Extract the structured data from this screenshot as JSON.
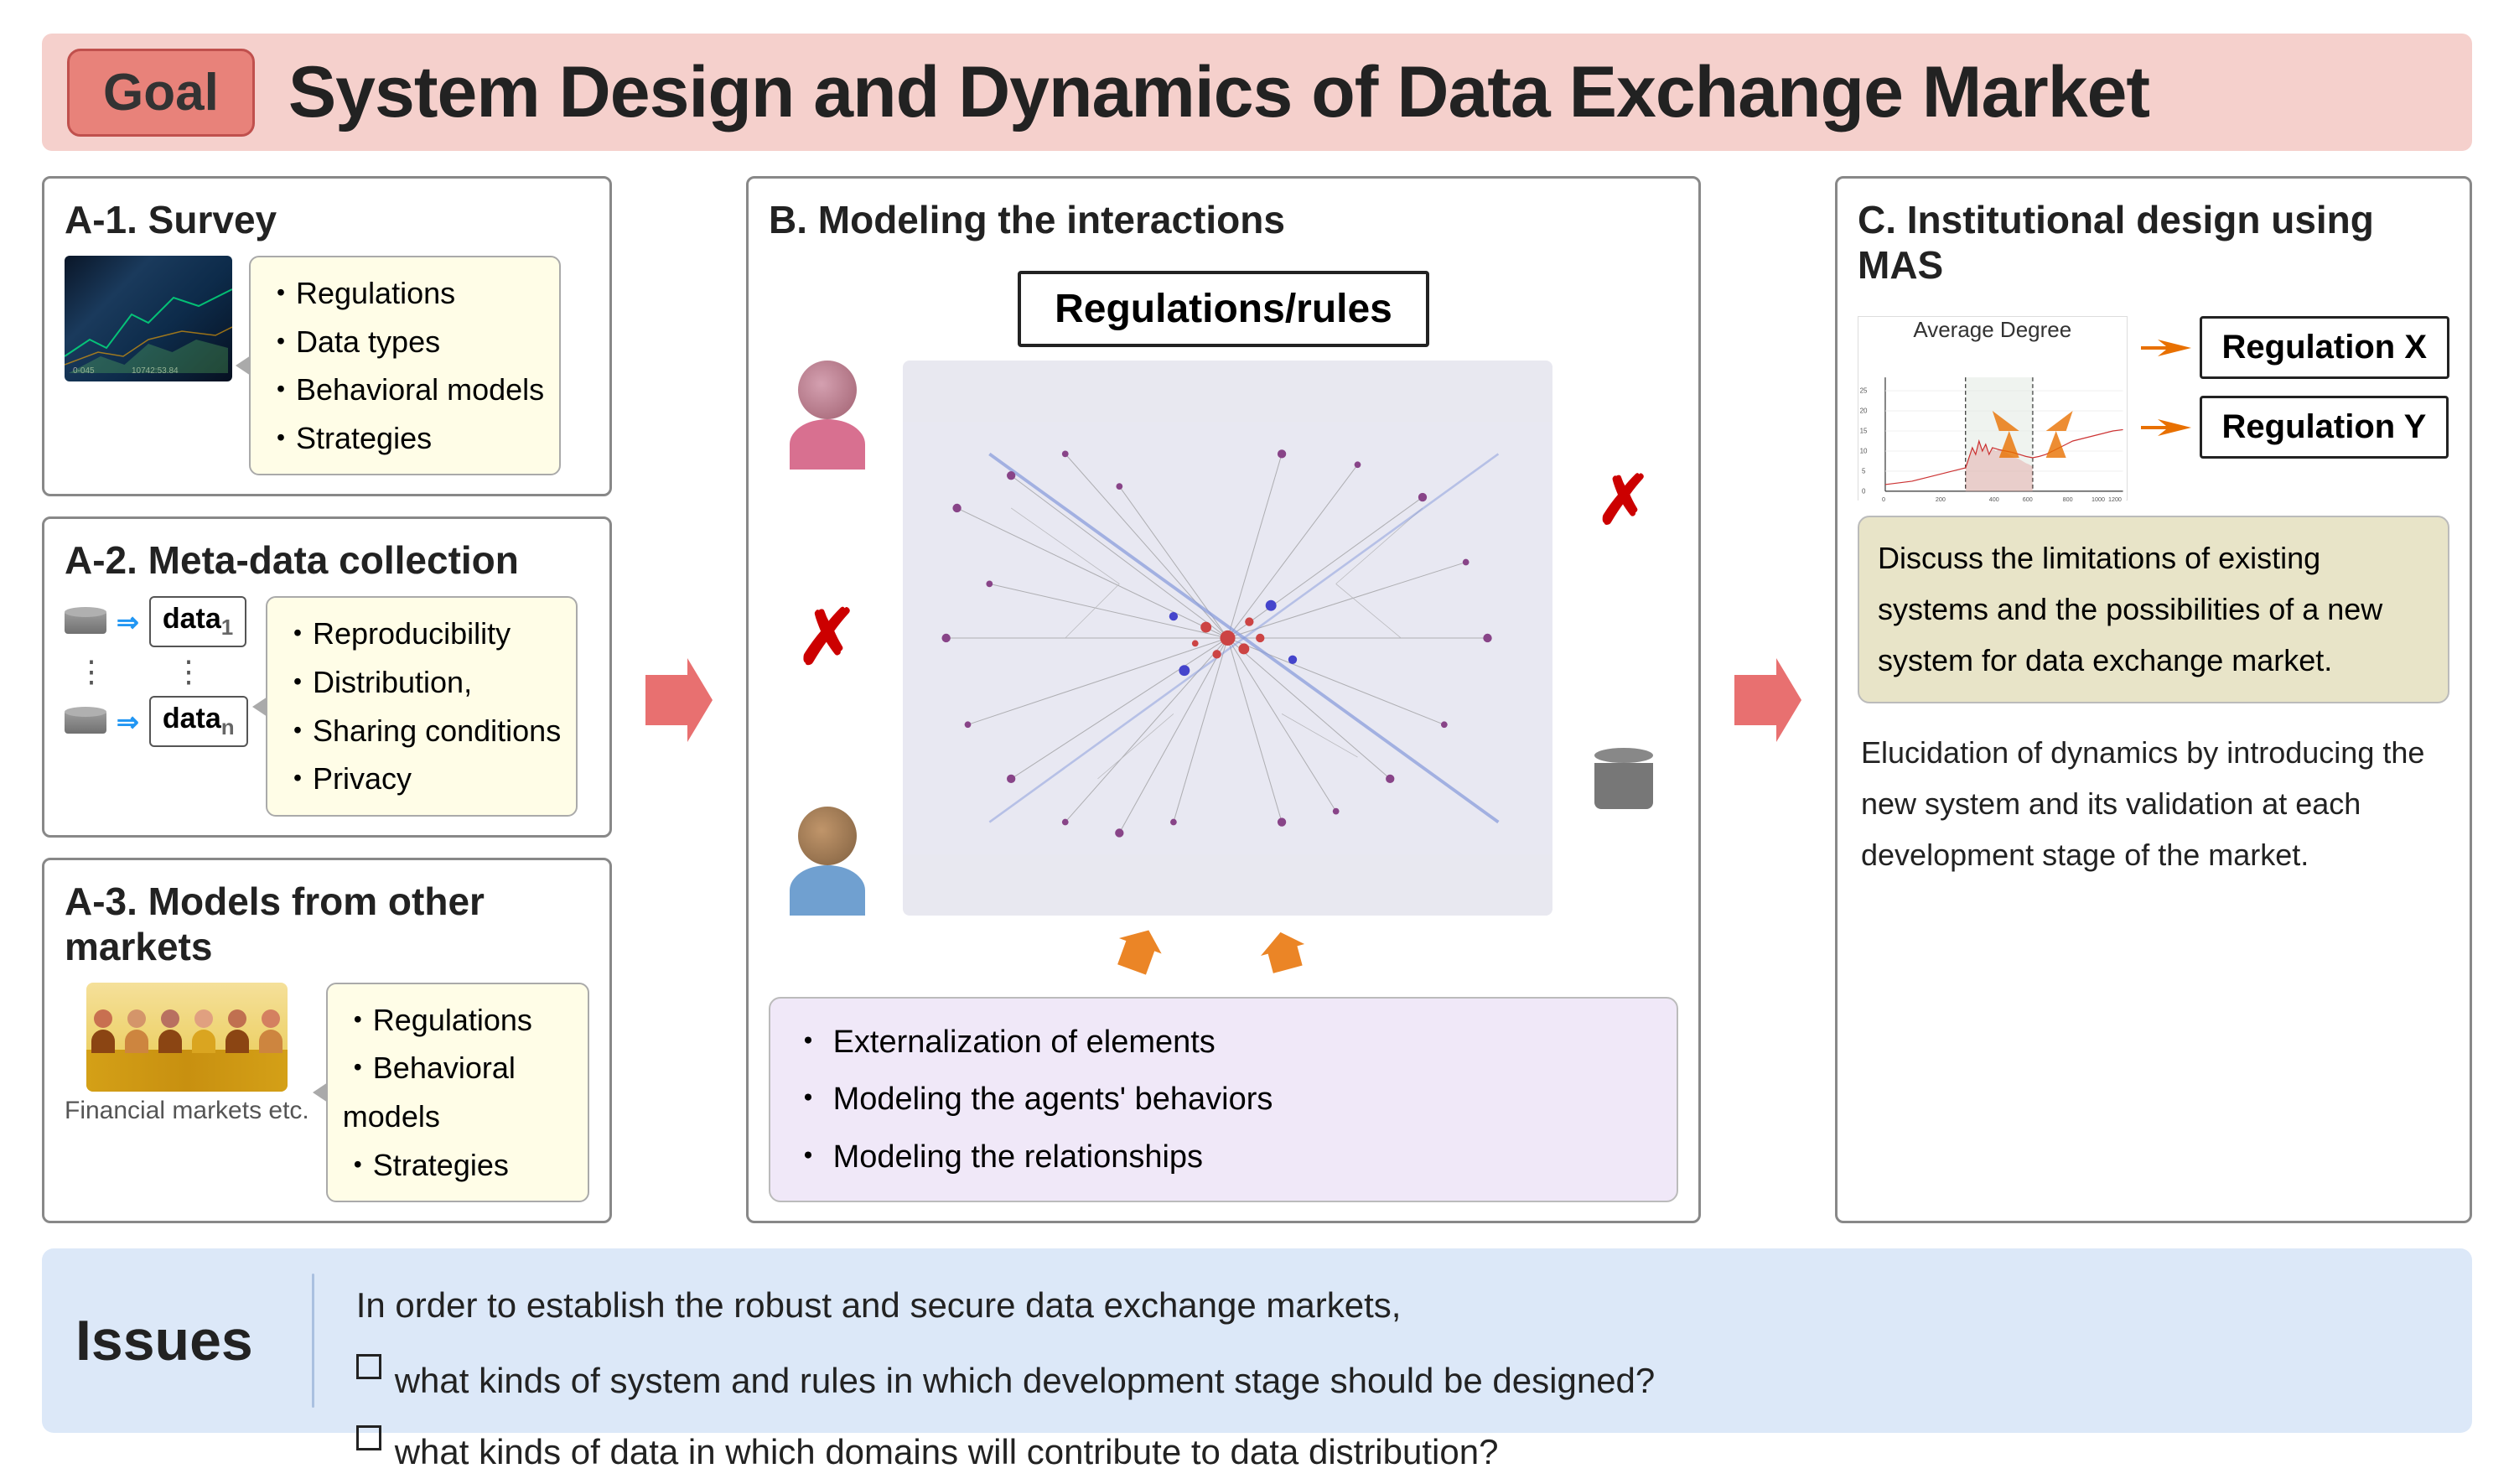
{
  "header": {
    "goal_label": "Goal",
    "title": "System Design and Dynamics of Data Exchange Market"
  },
  "sections": {
    "a1": {
      "title": "A-1. Survey",
      "bullet_items": [
        "Regulations",
        "Data types",
        "Behavioral models",
        "Strategies"
      ]
    },
    "a2": {
      "title": "A-2. Meta-data collection",
      "data_labels": [
        "data₁",
        "dataₙ"
      ],
      "bullet_items": [
        "Reproducibility",
        "Distribution,",
        "Sharing conditions",
        "Privacy"
      ]
    },
    "a3": {
      "title": "A-3. Models from other markets",
      "sublabel": "Financial markets etc.",
      "bullet_items": [
        "Regulations",
        "Behavioral models",
        "Strategies"
      ]
    },
    "b": {
      "title": "B. Modeling the interactions",
      "regulations_box": "Regulations/rules",
      "bullet_items": [
        "Externalization of elements",
        "Modeling the agents' behaviors",
        "Modeling the relationships"
      ]
    },
    "c": {
      "title": "C. Institutional design using MAS",
      "graph_title": "Average Degree",
      "regulation_x": "Regulation X",
      "regulation_y": "Regulation Y",
      "discuss_text": "Discuss the limitations of existing systems and the possibilities of a new system for data exchange market.",
      "elucidation_text": "Elucidation of dynamics by introducing the new system and its validation at each development stage of the market."
    }
  },
  "bottom": {
    "issues_label": "Issues",
    "main_text": "In order to establish the robust and secure data exchange markets,",
    "bullet1": "what kinds of system and rules in which development stage should be designed?",
    "bullet2": "what kinds of data in which domains will contribute to data distribution?"
  },
  "colors": {
    "pink_arrow": "#e87070",
    "orange_arrow": "#e87000",
    "header_bg": "#f5d0cc",
    "goal_bg": "#e8827a",
    "issues_bg": "#dce8f8",
    "network_bg": "#e0e0ee",
    "discuss_bg": "#e8e4c8",
    "bullet_b_bg": "#f0e8f8"
  }
}
